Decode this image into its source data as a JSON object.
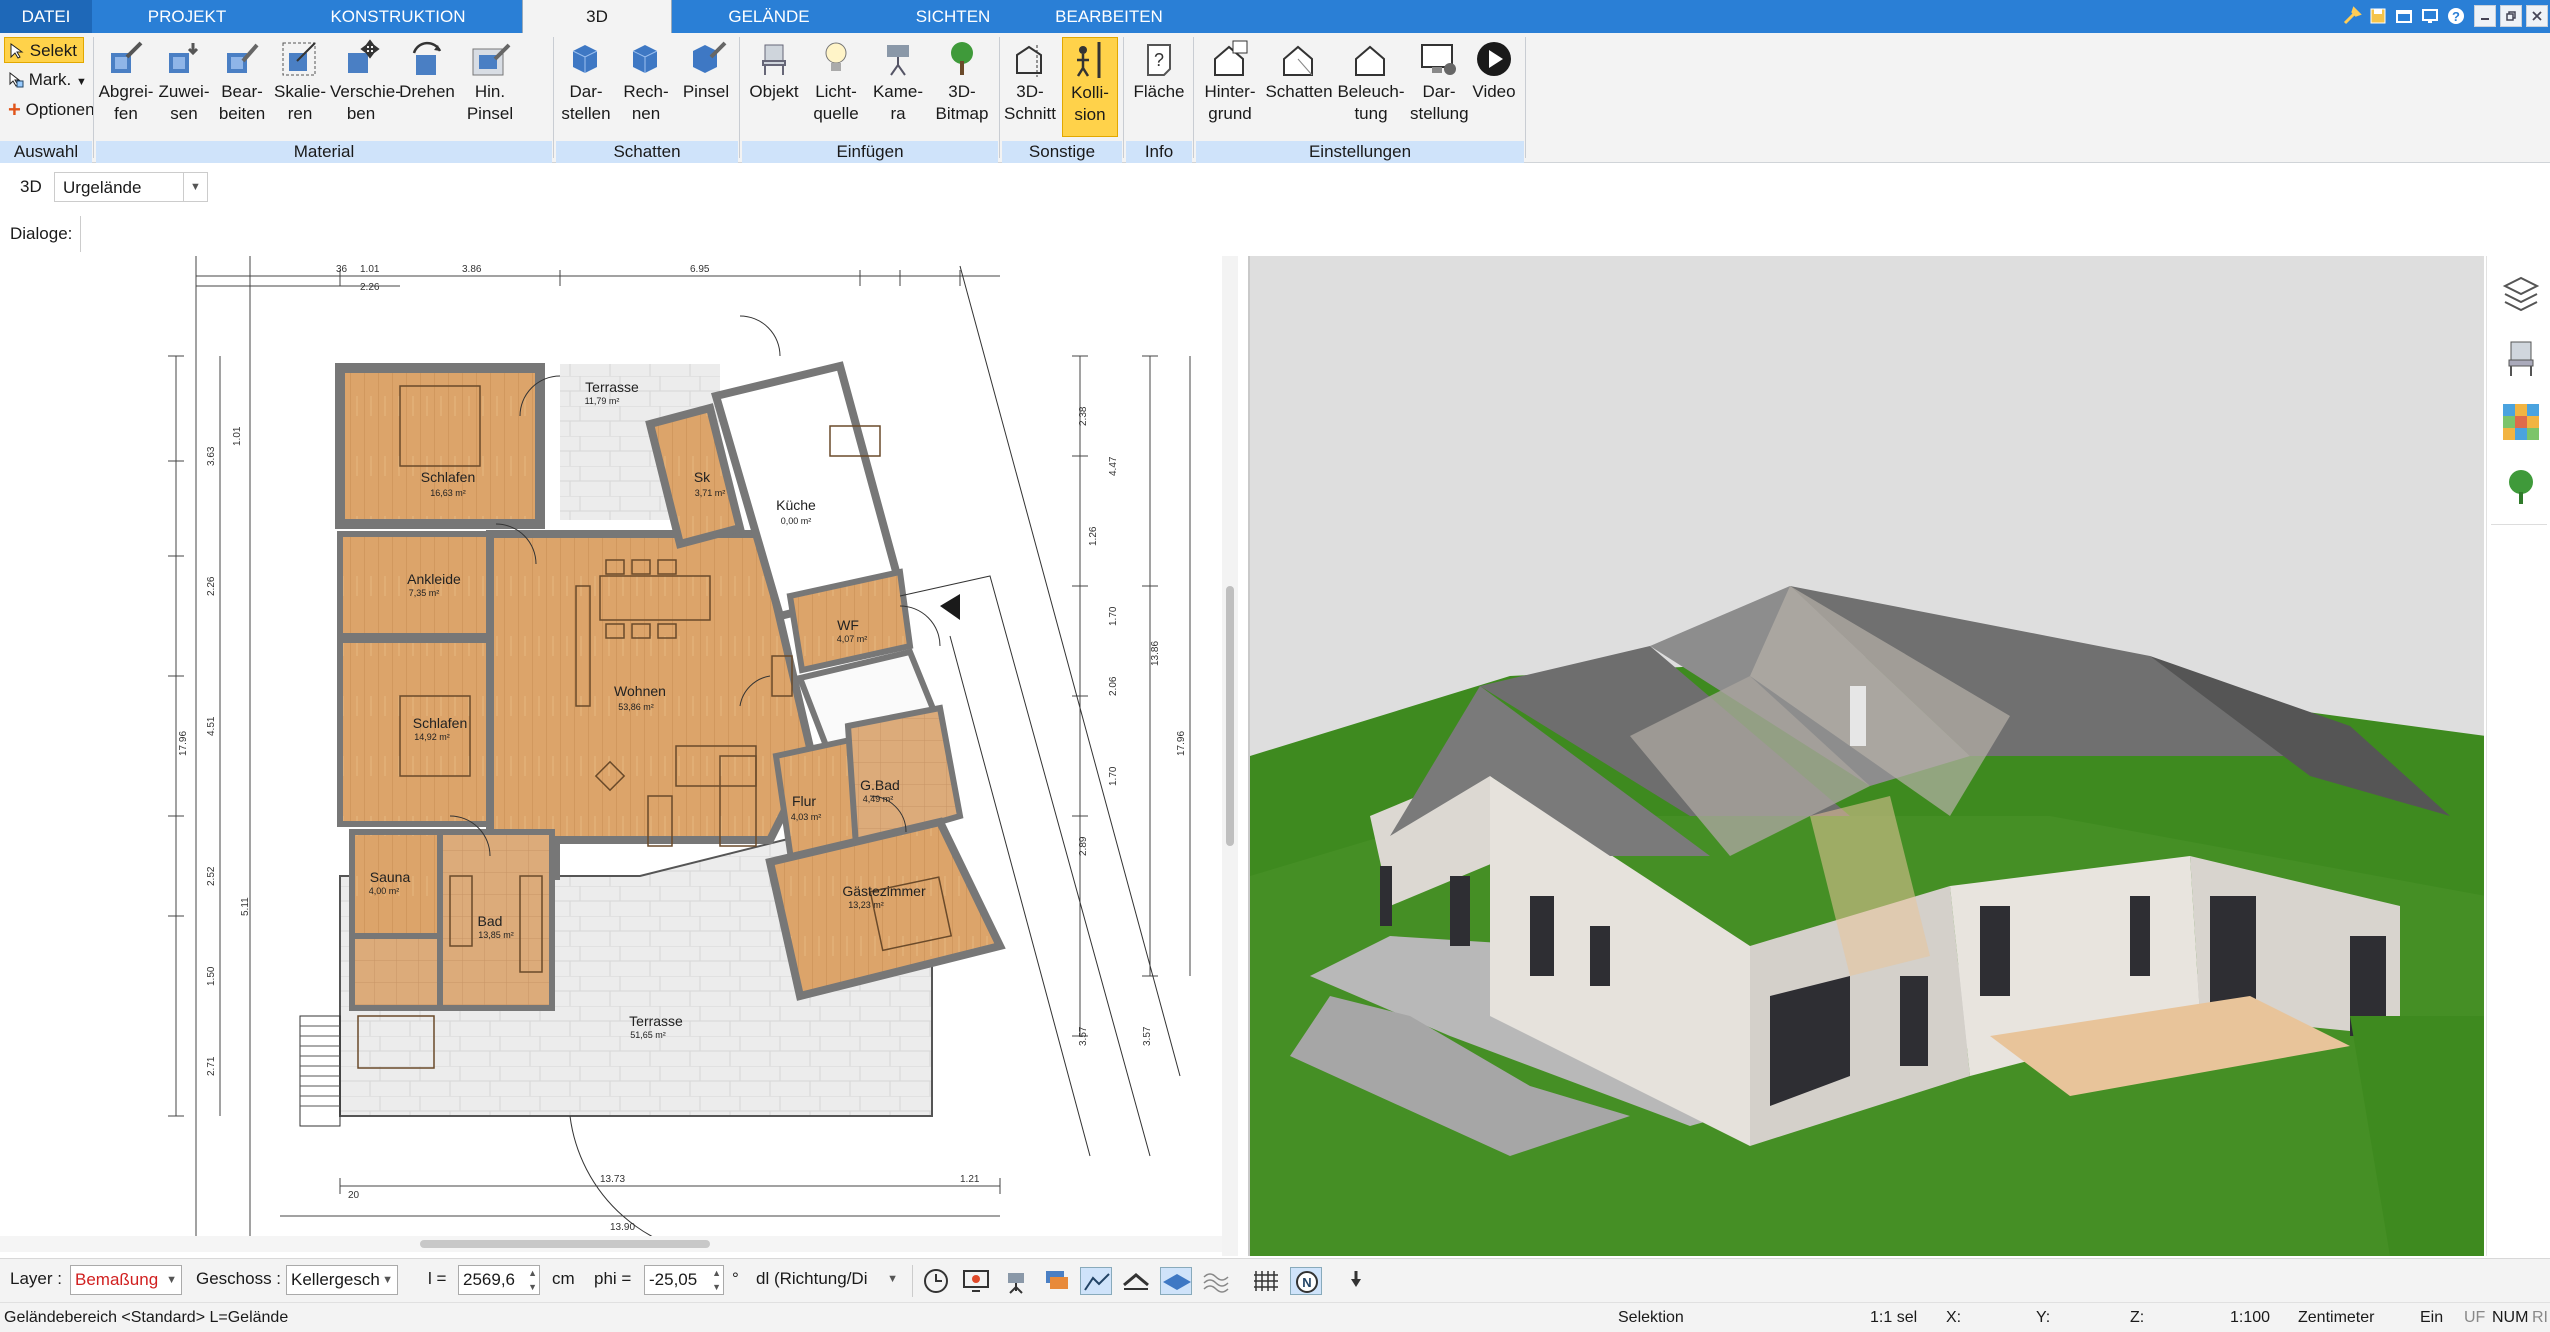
{
  "tabs": [
    "DATEI",
    "PROJEKT",
    "KONSTRUKTION",
    "3D",
    "GELÄNDE",
    "SICHTEN",
    "BEARBEITEN"
  ],
  "active_tab": "3D",
  "ribbon": {
    "auswahl": {
      "title": "Auswahl",
      "selekt": "Selekt",
      "mark": "Mark.",
      "optionen": "Optionen"
    },
    "material": {
      "title": "Material",
      "buttons": [
        "Abgrei-\nfen",
        "Zuwei-\nsen",
        "Bear-\nbeiten",
        "Skalie-\nren",
        "Verschie-\nben",
        "Drehen",
        "Hin.\nPinsel"
      ]
    },
    "schatten": {
      "title": "Schatten",
      "buttons": [
        "Dar-\nstellen",
        "Rech-\nnen",
        "Pinsel"
      ]
    },
    "einfuegen": {
      "title": "Einfügen",
      "buttons": [
        "Objekt",
        "Licht-\nquelle",
        "Kame-\nra",
        "3D-\nBitmap"
      ]
    },
    "sonstige": {
      "title": "Sonstige",
      "buttons": [
        "3D-\nSchnitt",
        "Kolli-\nsion"
      ]
    },
    "info": {
      "title": "Info",
      "buttons": [
        "Fläche"
      ]
    },
    "einstellungen": {
      "title": "Einstellungen",
      "buttons": [
        "Hinter-\ngrund",
        "Schatten",
        "Beleuch-\ntung",
        "Dar-\nstellung",
        "Video"
      ]
    }
  },
  "view_selector": {
    "mode": "3D",
    "value": "Urgelände"
  },
  "dialoge_label": "Dialoge:",
  "rooms": [
    {
      "name": "Terrasse",
      "area": "11,79 m²"
    },
    {
      "name": "Schlafen",
      "area": "16,63 m²"
    },
    {
      "name": "Sk",
      "area": "3,71 m²"
    },
    {
      "name": "Küche",
      "area": "0,00 m²"
    },
    {
      "name": "Ankleide",
      "area": "7,35 m²"
    },
    {
      "name": "Wohnen",
      "area": "53,86 m²"
    },
    {
      "name": "WF",
      "area": "4,07 m²"
    },
    {
      "name": "Schlafen",
      "area": "14,92 m²"
    },
    {
      "name": "G.Bad",
      "area": "4,49 m²"
    },
    {
      "name": "Flur",
      "area": "4,03 m²"
    },
    {
      "name": "Sauna",
      "area": "4,00 m²"
    },
    {
      "name": "Gästezimmer",
      "area": "13,23 m²"
    },
    {
      "name": "Bad",
      "area": "13,85 m²"
    },
    {
      "name": "Terrasse",
      "area": "51,65 m²"
    }
  ],
  "dims_top": [
    "36",
    "1.01",
    "3.86",
    "6.95",
    "2.26"
  ],
  "dims_left": [
    "3.63",
    "1.01",
    "2.26",
    "4.51",
    "2.52",
    "1.50",
    "5.11",
    "17.96",
    "2.71"
  ],
  "dims_right": [
    "2.38",
    "1.26",
    "1.70",
    "2.06",
    "1.70",
    "2.89",
    "3.57",
    "4.47",
    "13.86",
    "17.96",
    "3.57"
  ],
  "dims_bottom": [
    "13.73",
    "13.90",
    "1.21",
    "20"
  ],
  "bottom": {
    "layer_label": "Layer :",
    "layer_value": "Bemaßung",
    "geschoss_label": "Geschoss :",
    "geschoss_value": "Kellergesch",
    "l_label": "l =",
    "l_value": "2569,6",
    "l_unit": "cm",
    "phi_label": "phi =",
    "phi_value": "-25,05",
    "phi_unit": "°",
    "dl_value": "dl (Richtung/Di"
  },
  "status": {
    "left": "Geländebereich <Standard> L=Gelände",
    "mode": "Selektion",
    "scale_sel": "1:1 sel",
    "x": "X:",
    "y": "Y:",
    "z": "Z:",
    "scale": "1:100",
    "unit": "Zentimeter",
    "ein": "Ein",
    "uf": "UF",
    "num": "NUM",
    "ri": "RI"
  },
  "colors": {
    "accent": "#2a7fd6",
    "ribbon_group": "#cfe3fa",
    "active_tool": "#ffd24a",
    "floor": "#dca46a",
    "grass": "#3e8a1f",
    "layer_text": "#d12020"
  }
}
